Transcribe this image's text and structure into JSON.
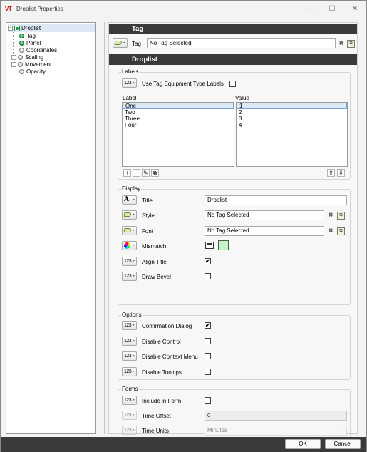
{
  "window": {
    "logo": "VT",
    "title": "Droplist Properties",
    "minimize_glyph": "—",
    "maximize_glyph": "☐",
    "close_glyph": "✕"
  },
  "tree": {
    "root": "Droplist",
    "items": [
      "Tag",
      "Panel",
      "Coordinates",
      "Scaling",
      "Movement",
      "Opacity"
    ]
  },
  "tag_section": {
    "header": "Tag",
    "label": "Tag",
    "value": "No Tag Selected"
  },
  "droplist_section": {
    "header": "Droplist"
  },
  "labels_group": {
    "title": "Labels",
    "use_equipment_label": "Use Tag Equipment Type Labels",
    "use_equipment_checked": false,
    "col_label": "Label",
    "col_value": "Value",
    "labels": [
      "One",
      "Two",
      "Three",
      "Four"
    ],
    "values": [
      "1",
      "2",
      "3",
      "4"
    ],
    "add_glyph": "+",
    "remove_glyph": "−",
    "edit_glyph": "✎",
    "paste_glyph": "⧉",
    "up_glyph": "⇧",
    "down_glyph": "⇩"
  },
  "display_group": {
    "title": "Display",
    "title_label": "Title",
    "title_value": "Droplist",
    "style_label": "Style",
    "style_value": "No Tag Selected",
    "font_label": "Font",
    "font_value": "No Tag Selected",
    "mismatch_label": "Mismatch",
    "mismatch_color": "#c4f5c4",
    "align_title_label": "Align Title",
    "align_title_checked": true,
    "draw_bevel_label": "Draw Bevel",
    "draw_bevel_checked": false
  },
  "options_group": {
    "title": "Options",
    "confirmation_label": "Confirmation Dialog",
    "confirmation_checked": true,
    "disable_control_label": "Disable Control",
    "disable_control_checked": false,
    "disable_context_label": "Disable Context Menu",
    "disable_context_checked": false,
    "disable_tooltips_label": "Disable Tooltips",
    "disable_tooltips_checked": false
  },
  "forms_group": {
    "title": "Forms",
    "include_label": "Include in Form",
    "include_checked": false,
    "time_offset_label": "Time Offset",
    "time_offset_value": "0",
    "time_units_label": "Time Units",
    "time_units_value": "Minutes"
  },
  "glyphs": {
    "num": "123",
    "font_a": "A",
    "arrow": "▸",
    "check": "✔",
    "clear": "✖",
    "chevron": "⌄",
    "browse": "⧉"
  },
  "footer": {
    "ok": "OK",
    "cancel": "Cancel"
  },
  "colors": {
    "section_header": "#3a3a3a",
    "selection": "#dceaf8",
    "accent_logo": "#c31212"
  }
}
